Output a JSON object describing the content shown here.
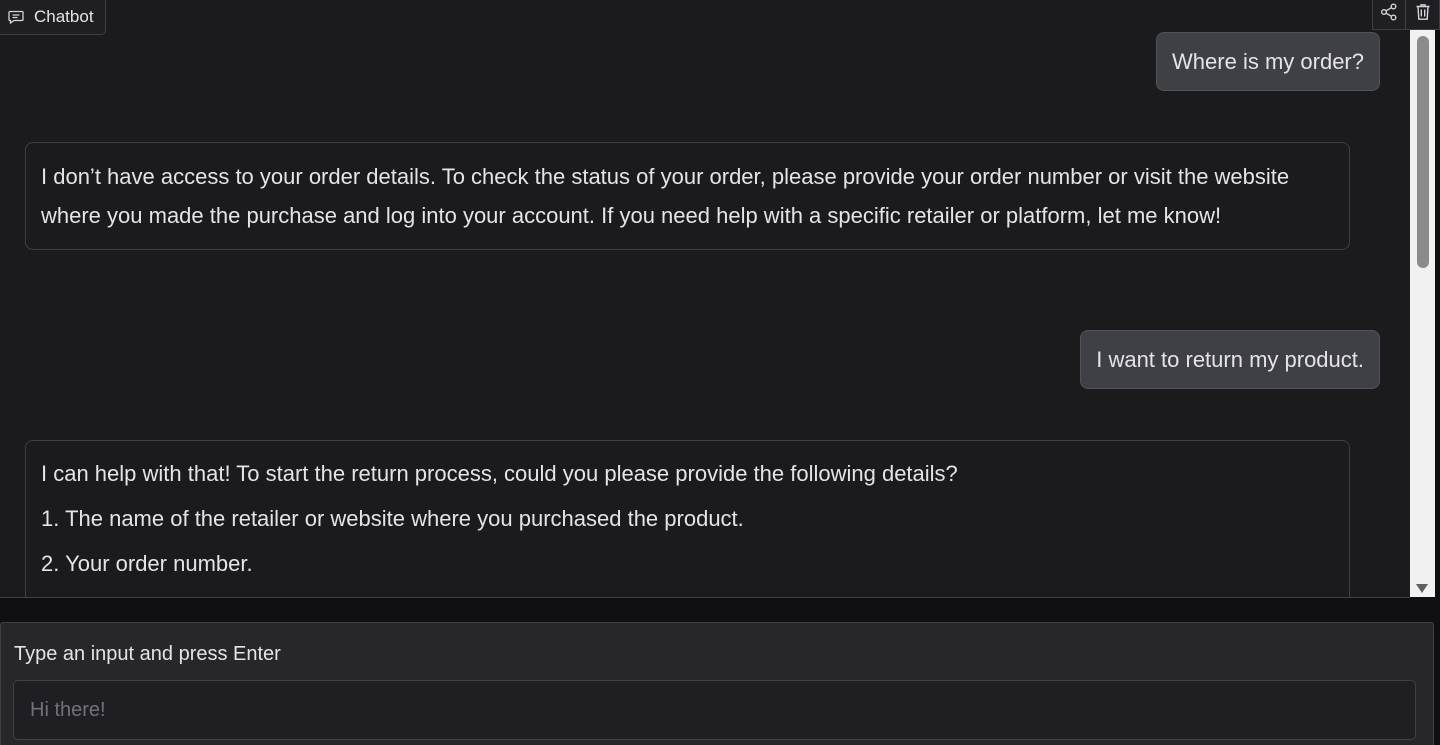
{
  "chatbot": {
    "label": "Chatbot",
    "icons": {
      "label": "chat-bubble-icon",
      "share": "share-icon",
      "delete": "trash-icon"
    },
    "messages": [
      {
        "role": "user",
        "text": "Where is my order?"
      },
      {
        "role": "bot",
        "paragraphs": [
          "I don’t have access to your order details. To check the status of your order, please provide your order number or visit the website where you made the purchase and log into your account. If you need help with a specific retailer or platform, let me know!"
        ]
      },
      {
        "role": "user",
        "text": "I want to return my product."
      },
      {
        "role": "bot",
        "paragraphs": [
          "I can help with that! To start the return process, could you please provide the following details?",
          "1. The name of the retailer or website where you purchased the product.",
          "2. Your order number."
        ]
      }
    ]
  },
  "input": {
    "label": "Type an input and press Enter",
    "placeholder": "Hi there!",
    "value": ""
  },
  "colors": {
    "background": "#1b1b1e",
    "user_bubble": "#3f3f46",
    "border": "#3f3f46",
    "text": "#e4e4e7"
  }
}
